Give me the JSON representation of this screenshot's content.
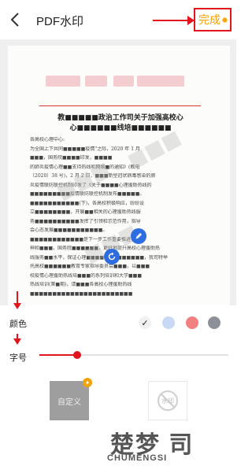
{
  "header": {
    "title": "PDF水印",
    "done_label": "完成",
    "accent": "#f2a20a"
  },
  "document": {
    "title_line1": "教■■■■■政治工作司关于加强高校心",
    "title_line2": "心■■■■■■线培■■■■■■",
    "lines": [
      "各高校心理中心:",
      "为全国上下共同■■■■■疫情\"之际，2020 年 1 月",
      "■■■，国务院■■■■印发，■■■■",
      "的肺炎疫情心理■■支持热线和网络■的通知》(教电",
      "〔2020〕38 号)，2 月 2 日，■■■新型冠状病毒感染的肺",
      "炎疫情联防联控机制印发了《关于■■■■心理援助热线的",
      "■■■■■■■■■疫情联防联控机制发布■■■■■。",
      "■■■■■■■■■■■(下)，各高校积极响应，纷纷设",
      "立■■■■■■■■，开展■■相关的心理援助热线服",
      "务■■■■■■■■■■发挥了引领和示范作用，指导",
      "会心态发展■■■■■■■■■■■。",
      "■■■■■■■■■■■■是下一步工作重要推进手精",
      "神和■■■，国务院■■■■■■，更好地提升高校心理援助热",
      "线服务■■水平，保证心理■■■■■■■■■■■■■，我司特举",
      "托高校■■■■■■教育专家指导委员会■■■，以■■■",
      "校疫情心理援助热线培■■■的系列培训和大学■■■",
      "热线培训(第■期)，请■■■各高校心理援助热线",
      "■■■■■■■■■■■■■■■■■■■■■■■"
    ],
    "watermark_text": "■■■"
  },
  "controls": {
    "color_label": "颜色",
    "size_label": "字号",
    "colors": [
      "#f1f1f1",
      "#c9d9f5",
      "#f28080",
      "#8d9098"
    ],
    "selected_color_index": 0,
    "font_size_fraction": 0.2,
    "slider_accent": "#e0161c"
  },
  "options": {
    "custom_label": "自定义",
    "none_label": "水印"
  },
  "brand": {
    "logo_text_cn": "楚梦 司",
    "logo_text_en": "CHUMENGSI"
  }
}
